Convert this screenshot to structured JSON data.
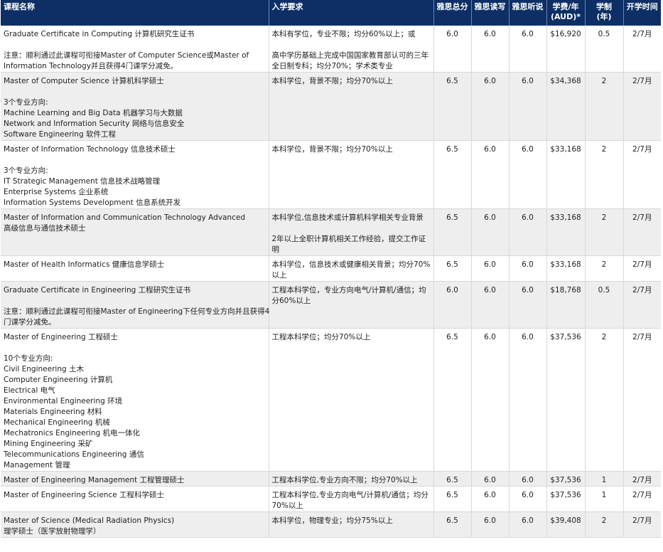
{
  "headers": {
    "course": "课程名称",
    "requirement": "入学要求",
    "ielts_total": "雅思总分",
    "ielts_rw": "雅思读写",
    "ielts_ls": "雅思听说",
    "tuition": "学费/年 (AUD)*",
    "duration": "学制 (年)",
    "intake": "开学时间"
  },
  "rows": [
    {
      "course": [
        [
          "Graduate Certificate in Computing 计算机研究生证书"
        ],
        [
          "注意：顺利通过此课程可衔接Master of Computer Science或Master of",
          "Information Technology并且获得4门课学分减免。"
        ]
      ],
      "requirement": [
        [
          "本科有学位，专业不限；均分60%以上；或"
        ],
        [
          "高中学历基础上完成中国国家教育部认可的三年",
          "全日制专科；均分70%；学术类专业"
        ]
      ],
      "ielts_total": "6.0",
      "ielts_rw": "6.0",
      "ielts_ls": "6.0",
      "tuition": "$16,920",
      "duration": "0.5",
      "intake": "2/7月"
    },
    {
      "course": [
        [
          "Master of Computer Science 计算机科学硕士"
        ],
        [
          "3个专业方向:",
          "Machine Learning and Big Data 机器学习与大数据",
          "Network and Information Security 网络与信息安全",
          "Software Engineering 软件工程"
        ]
      ],
      "requirement": [
        [
          "本科学位，背景不限；均分70%以上"
        ]
      ],
      "ielts_total": "6.5",
      "ielts_rw": "6.0",
      "ielts_ls": "6.0",
      "tuition": "$34,368",
      "duration": "2",
      "intake": "2/7月"
    },
    {
      "course": [
        [
          "Master of Information Technology 信息技术硕士"
        ],
        [
          "3个专业方向:",
          "IT Strategic Management 信息技术战略管理",
          "Enterprise Systems 企业系统",
          "Information Systems Development 信息系统开发"
        ]
      ],
      "requirement": [
        [
          "本科学位，背景不限；均分70%以上"
        ]
      ],
      "ielts_total": "6.5",
      "ielts_rw": "6.0",
      "ielts_ls": "6.0",
      "tuition": "$33,168",
      "duration": "2",
      "intake": "2/7月"
    },
    {
      "course": [
        [
          "Master of Information and Communication Technology Advanced",
          "高级信息与通信技术硕士"
        ]
      ],
      "requirement": [
        [
          "本科学位,信息技术或计算机科学相关专业背景"
        ],
        [
          "2年以上全职计算机相关工作经验，提交工作证",
          "明"
        ]
      ],
      "ielts_total": "6.5",
      "ielts_rw": "6.0",
      "ielts_ls": "6.0",
      "tuition": "$33,168",
      "duration": "2",
      "intake": "2/7月"
    },
    {
      "course": [
        [
          "Master of Health Informatics 健康信息学硕士"
        ]
      ],
      "requirement": [
        [
          "本科学位，信息技术或健康相关背景；均分70%",
          "以上"
        ]
      ],
      "ielts_total": "6.5",
      "ielts_rw": "6.0",
      "ielts_ls": "6.0",
      "tuition": "$33,168",
      "duration": "2",
      "intake": "2/7月"
    },
    {
      "course": [
        [
          "Graduate Certificate in Engineering 工程研究生证书"
        ],
        [
          "注意：顺利通过此课程可衔接Master of Engineering下任何专业方向并且获得4",
          "门课学分减免。"
        ]
      ],
      "requirement": [
        [
          "工程本科学位，专业方向电气/计算机/通信；均",
          "分60%以上"
        ]
      ],
      "ielts_total": "6.0",
      "ielts_rw": "6.0",
      "ielts_ls": "6.0",
      "tuition": "$18,768",
      "duration": "0.5",
      "intake": "2/7月"
    },
    {
      "course": [
        [
          "Master of Engineering 工程硕士"
        ],
        [
          "10个专业方向:",
          "Civil Engineering 土木",
          "Computer Engineering 计算机",
          "Electrical 电气",
          "Environmental Engineering 环境",
          "Materials Engineering 材料",
          "Mechanical Engineering 机械",
          "Mechatronics Engineering 机电一体化",
          "Mining Engineering 采矿",
          "Telecommunications Engineering 通信",
          "Management 管理"
        ]
      ],
      "requirement": [
        [
          "工程本科学位；均分70%以上"
        ]
      ],
      "ielts_total": "6.5",
      "ielts_rw": "6.0",
      "ielts_ls": "6.0",
      "tuition": "$37,536",
      "duration": "2",
      "intake": "2/7月"
    },
    {
      "course": [
        [
          "Master of Engineering Management 工程管理硕士"
        ]
      ],
      "requirement": [
        [
          "工程本科学位,专业方向不限；均分70%以上"
        ]
      ],
      "ielts_total": "6.5",
      "ielts_rw": "6.0",
      "ielts_ls": "6.0",
      "tuition": "$37,536",
      "duration": "1",
      "intake": "2/7月"
    },
    {
      "course": [
        [
          "Master of Engineering Science 工程科学硕士"
        ]
      ],
      "requirement": [
        [
          "工程本科学位,专业方向电气/计算机/通信；均分",
          "70%以上"
        ]
      ],
      "ielts_total": "6.5",
      "ielts_rw": "6.0",
      "ielts_ls": "6.0",
      "tuition": "$37,536",
      "duration": "1",
      "intake": "2/7月"
    },
    {
      "course": [
        [
          "Master of Science (Medical Radiation Physics)",
          "理学硕士（医学放射物理学）"
        ]
      ],
      "requirement": [
        [
          "本科学位，物理专业；均分75%以上"
        ]
      ],
      "ielts_total": "6.5",
      "ielts_rw": "6.0",
      "ielts_ls": "6.0",
      "tuition": "$39,408",
      "duration": "2",
      "intake": "2/7月"
    }
  ]
}
